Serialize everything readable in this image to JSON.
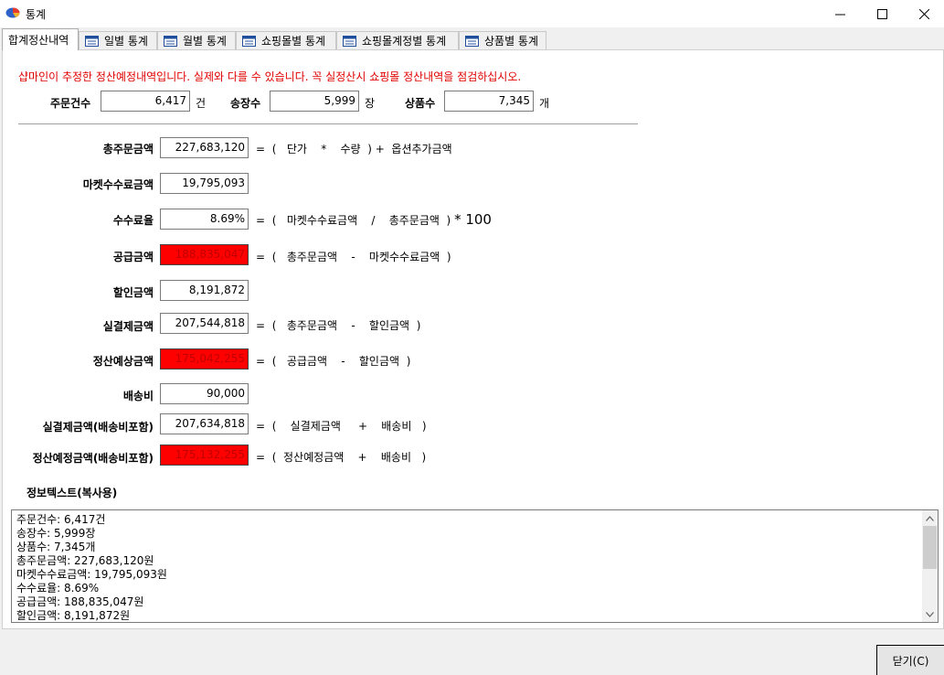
{
  "window": {
    "title": "통계"
  },
  "tabs": [
    {
      "label": "합계정산내역"
    },
    {
      "label": "일별 통계"
    },
    {
      "label": "월별 통계"
    },
    {
      "label": "쇼핑몰별 통계"
    },
    {
      "label": "쇼핑몰계정별 통계"
    },
    {
      "label": "상품별 통계"
    }
  ],
  "warning": "샵마인이 추정한 정산예정내역입니다. 실제와 다를 수 있습니다. 꼭 실정산시 쇼핑몰 정산내역을 점검하십시오.",
  "summary": {
    "orders": {
      "label": "주문건수",
      "value": "6,417",
      "unit": "건"
    },
    "invoices": {
      "label": "송장수",
      "value": "5,999",
      "unit": "장"
    },
    "products": {
      "label": "상품수",
      "value": "7,345",
      "unit": "개"
    }
  },
  "rows": [
    {
      "label": "총주문금액",
      "value": "227,683,120",
      "formula": [
        "=",
        "(",
        "단가",
        "*",
        "수량",
        ")",
        "+",
        "옵션추가금액"
      ]
    },
    {
      "label": "마켓수수료금액",
      "value": "19,795,093"
    },
    {
      "label": "수수료율",
      "value": "8.69%",
      "formula": [
        "=",
        "(",
        "마켓수수료금액",
        "/",
        "총주문금액",
        ")",
        "* 100"
      ]
    },
    {
      "label": "공급금액",
      "value": "188,835,047",
      "formula": [
        "=",
        "(",
        "총주문금액",
        "-",
        "마켓수수료금액",
        ")"
      ]
    },
    {
      "label": "할인금액",
      "value": "8,191,872"
    },
    {
      "label": "실결제금액",
      "value": "207,544,818",
      "formula": [
        "=",
        "(",
        "총주문금액",
        "-",
        "할인금액",
        ")"
      ]
    },
    {
      "label": "정산예상금액",
      "value": "175,042,255",
      "formula": [
        "=",
        "(",
        "공급금액",
        "-",
        "할인금액",
        ")"
      ]
    },
    {
      "label": "배송비",
      "value": "90,000"
    },
    {
      "label": "실결제금액(배송비포함)",
      "value": "207,634,818",
      "formula": [
        "=",
        "(",
        "실결제금액",
        "+",
        "배송비",
        ")"
      ]
    },
    {
      "label": "정산예정금액(배송비포함)",
      "value": "175,132,255",
      "formula": [
        "=",
        "(",
        "정산예정금액",
        "+",
        "배송비",
        ")"
      ]
    }
  ],
  "info": {
    "title": "정보텍스트(복사용)",
    "lines": [
      "주문건수: 6,417건",
      "송장수: 5,999장",
      "상품수: 7,345개",
      "총주문금액: 227,683,120원",
      "마켓수수료금액: 19,795,093원",
      "수수료율: 8.69%",
      "공급금액: 188,835,047원",
      "할인금액: 8,191,872원"
    ]
  },
  "close_button": "닫기(C)",
  "colors": {
    "warning": "#e00000",
    "highlight_field": "#ff0000"
  }
}
